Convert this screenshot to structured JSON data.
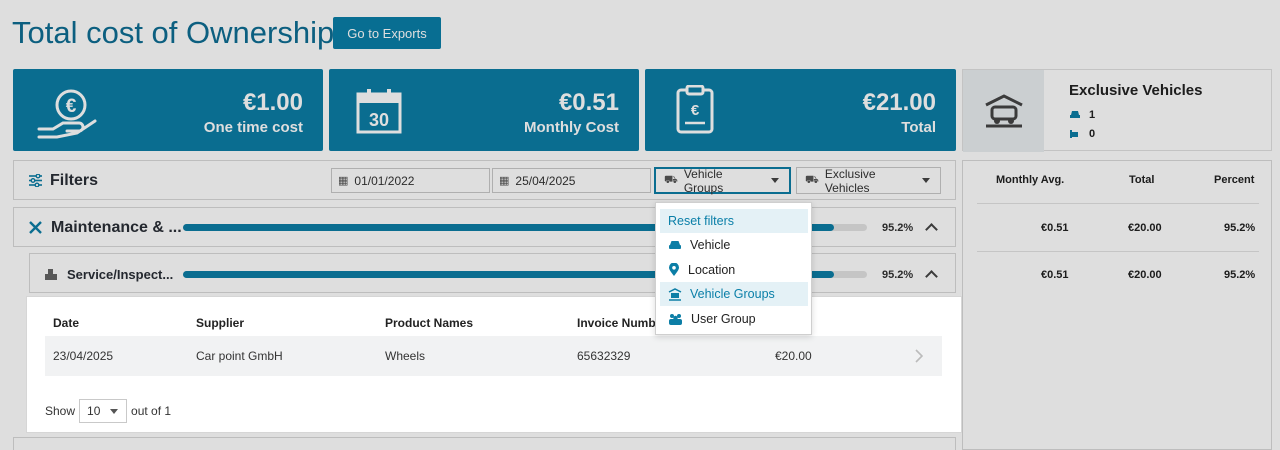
{
  "page": {
    "title": "Total cost of Ownership",
    "export_button": "Go to Exports"
  },
  "kpis": [
    {
      "value": "€1.00",
      "label": "One time cost",
      "icon": "euro-hand-icon"
    },
    {
      "value": "€0.51",
      "label": "Monthly Cost",
      "icon": "calendar-icon",
      "icon_text": "30"
    },
    {
      "value": "€21.00",
      "label": "Total",
      "icon": "invoice-icon"
    }
  ],
  "exclusive": {
    "title": "Exclusive Vehicles",
    "cars": "1",
    "other": "0"
  },
  "filters": {
    "title": "Filters",
    "date_from": "01/01/2022",
    "date_to": "25/04/2025",
    "vehicle_groups_label": "Vehicle Groups",
    "exclusive_label": "Exclusive Vehicles"
  },
  "dropdown": {
    "reset": "Reset filters",
    "items": [
      "Vehicle",
      "Location",
      "Vehicle Groups",
      "User Group"
    ]
  },
  "categories": [
    {
      "name": "Maintenance & ...",
      "percent": "95.2%",
      "progress": 0.952,
      "monthly_avg": "€0.51",
      "total": "€20.00",
      "pct": "95.2%"
    },
    {
      "name": "Service/Inspect...",
      "percent": "95.2%",
      "progress": 0.952,
      "monthly_avg": "€0.51",
      "total": "€20.00",
      "pct": "95.2%"
    }
  ],
  "summary_headers": {
    "monthly_avg": "Monthly Avg.",
    "total": "Total",
    "percent": "Percent"
  },
  "table": {
    "headers": [
      "Date",
      "Supplier",
      "Product Names",
      "Invoice Numb"
    ],
    "rows": [
      {
        "date": "23/04/2025",
        "supplier": "Car point GmbH",
        "product": "Wheels",
        "invoice": "65632329",
        "amount": "€20.00"
      }
    ],
    "show_label": "Show",
    "page_size": "10",
    "pagination": "out of 1"
  },
  "colors": {
    "primary": "#0c7ea6",
    "title": "#0e6e93"
  }
}
